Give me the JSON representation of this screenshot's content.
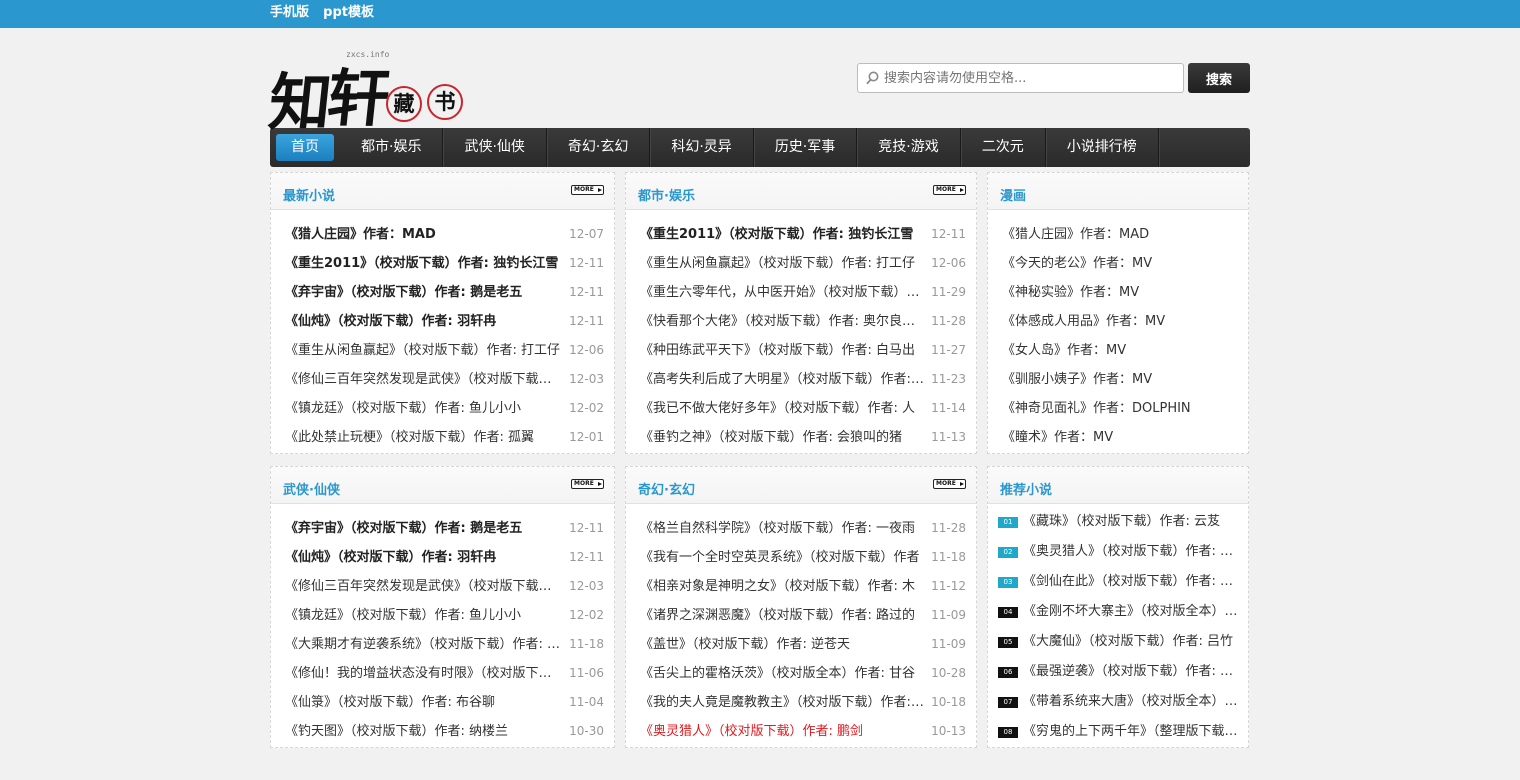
{
  "topbar": {
    "links": [
      "手机版",
      "ppt模板"
    ]
  },
  "logo": {
    "chars": [
      "知",
      "轩"
    ],
    "seal": [
      "藏",
      "书"
    ],
    "site": "zxcs.info"
  },
  "search": {
    "placeholder": "搜索内容请勿使用空格...",
    "button": "搜索"
  },
  "nav": [
    "首页",
    "都市·娱乐",
    "武侠·仙侠",
    "奇幻·玄幻",
    "科幻·灵异",
    "历史·军事",
    "竞技·游戏",
    "二次元",
    "小说排行榜"
  ],
  "more_label": "MORE",
  "boxes": [
    {
      "title": "最新小说",
      "has_more": true,
      "items": [
        {
          "t": "《猎人庄园》作者：MAD",
          "d": "12-07",
          "bold": true
        },
        {
          "t": "《重生2011》（校对版下载）作者: 独钓长江雪",
          "d": "12-11",
          "bold": true
        },
        {
          "t": "《弃宇宙》（校对版下载）作者: 鹅是老五",
          "d": "12-11",
          "bold": true
        },
        {
          "t": "《仙炖》（校对版下载）作者: 羽轩冉",
          "d": "12-11",
          "bold": true
        },
        {
          "t": "《重生从闲鱼赢起》（校对版下载）作者: 打工仔",
          "d": "12-06"
        },
        {
          "t": "《修仙三百年突然发现是武侠》（校对版下载）作者: 行者",
          "d": "12-03"
        },
        {
          "t": "《镇龙廷》（校对版下载）作者: 鱼儿小小",
          "d": "12-02"
        },
        {
          "t": "《此处禁止玩梗》（校对版下载）作者: 孤翼",
          "d": "12-01"
        }
      ]
    },
    {
      "title": "都市·娱乐",
      "has_more": true,
      "items": [
        {
          "t": "《重生2011》（校对版下载）作者: 独钓长江雪",
          "d": "12-11",
          "bold": true
        },
        {
          "t": "《重生从闲鱼赢起》（校对版下载）作者: 打工仔",
          "d": "12-06"
        },
        {
          "t": "《重生六零年代，从中医开始》（校对版下载）作者",
          "d": "11-29"
        },
        {
          "t": "《快看那个大佬》（校对版下载）作者: 奥尔良烤鲟鱼",
          "d": "11-28"
        },
        {
          "t": "《种田练武平天下》（校对版下载）作者: 白马出",
          "d": "11-27"
        },
        {
          "t": "《高考失利后成了大明星》（校对版下载）作者: 木子",
          "d": "11-23"
        },
        {
          "t": "《我已不做大佬好多年》（校对版下载）作者: 人",
          "d": "11-14"
        },
        {
          "t": "《垂钓之神》（校对版下载）作者: 会狼叫的猪",
          "d": "11-13"
        }
      ]
    },
    {
      "title": "漫画",
      "has_more": false,
      "items": [
        {
          "t": "《猎人庄园》作者：MAD"
        },
        {
          "t": "《今天的老公》作者：MV"
        },
        {
          "t": "《神秘实验》作者：MV"
        },
        {
          "t": "《体感成人用品》作者：MV"
        },
        {
          "t": "《女人岛》作者：MV"
        },
        {
          "t": "《驯服小姨子》作者：MV"
        },
        {
          "t": "《神奇见面礼》作者：DOLPHIN"
        },
        {
          "t": "《瞳术》作者：MV"
        }
      ]
    },
    {
      "title": "武侠·仙侠",
      "has_more": true,
      "items": [
        {
          "t": "《弃宇宙》（校对版下载）作者: 鹅是老五",
          "d": "12-11",
          "bold": true
        },
        {
          "t": "《仙炖》（校对版下载）作者: 羽轩冉",
          "d": "12-11",
          "bold": true
        },
        {
          "t": "《修仙三百年突然发现是武侠》（校对版下载）作者: 行者",
          "d": "12-03"
        },
        {
          "t": "《镇龙廷》（校对版下载）作者: 鱼儿小小",
          "d": "12-02"
        },
        {
          "t": "《大乘期才有逆袭系统》（校对版下载）作者: 十三",
          "d": "11-18"
        },
        {
          "t": "《修仙！我的增益状态没有时限》（校对版下载）作者",
          "d": "11-06"
        },
        {
          "t": "《仙箓》（校对版下载）作者: 布谷聊",
          "d": "11-04"
        },
        {
          "t": "《钓天图》（校对版下载）作者: 纳楼兰",
          "d": "10-30"
        }
      ]
    },
    {
      "title": "奇幻·玄幻",
      "has_more": true,
      "items": [
        {
          "t": "《格兰自然科学院》（校对版下载）作者: 一夜雨",
          "d": "11-28"
        },
        {
          "t": "《我有一个全时空英灵系统》（校对版下载）作者",
          "d": "11-18"
        },
        {
          "t": "《相亲对象是神明之女》（校对版下载）作者: 木",
          "d": "11-12"
        },
        {
          "t": "《诸界之深渊恶魔》（校对版下载）作者: 路过的",
          "d": "11-09"
        },
        {
          "t": "《盖世》（校对版下载）作者: 逆苍天",
          "d": "11-09"
        },
        {
          "t": "《舌尖上的霍格沃茨》（校对版全本）作者: 甘谷",
          "d": "10-28"
        },
        {
          "t": "《我的夫人竟是魔教教主》（校对版下载）作者: 星",
          "d": "10-18"
        },
        {
          "t": "《奥灵猎人》（校对版下载）作者: 鹏剑",
          "d": "10-13",
          "red": true
        }
      ]
    },
    {
      "title": "推荐小说",
      "has_more": false,
      "rank": true,
      "items": [
        {
          "n": "01",
          "t": "《藏珠》（校对版下载）作者: 云芨"
        },
        {
          "n": "02",
          "t": "《奥灵猎人》（校对版下载）作者: 鹏剑"
        },
        {
          "n": "03",
          "t": "《剑仙在此》（校对版下载）作者: 乱世狂刀"
        },
        {
          "n": "04",
          "t": "《金刚不坏大寨主》（校对版全本）作者: 郭子"
        },
        {
          "n": "05",
          "t": "《大魔仙》（校对版下载）作者: 吕竹"
        },
        {
          "n": "06",
          "t": "《最强逆袭》（校对版下载）作者: 乌龙"
        },
        {
          "n": "07",
          "t": "《带着系统来大唐》（校对版全本）作者: 小"
        },
        {
          "n": "08",
          "t": "《穷鬼的上下两千年》（整理版下载）作者"
        }
      ]
    }
  ]
}
